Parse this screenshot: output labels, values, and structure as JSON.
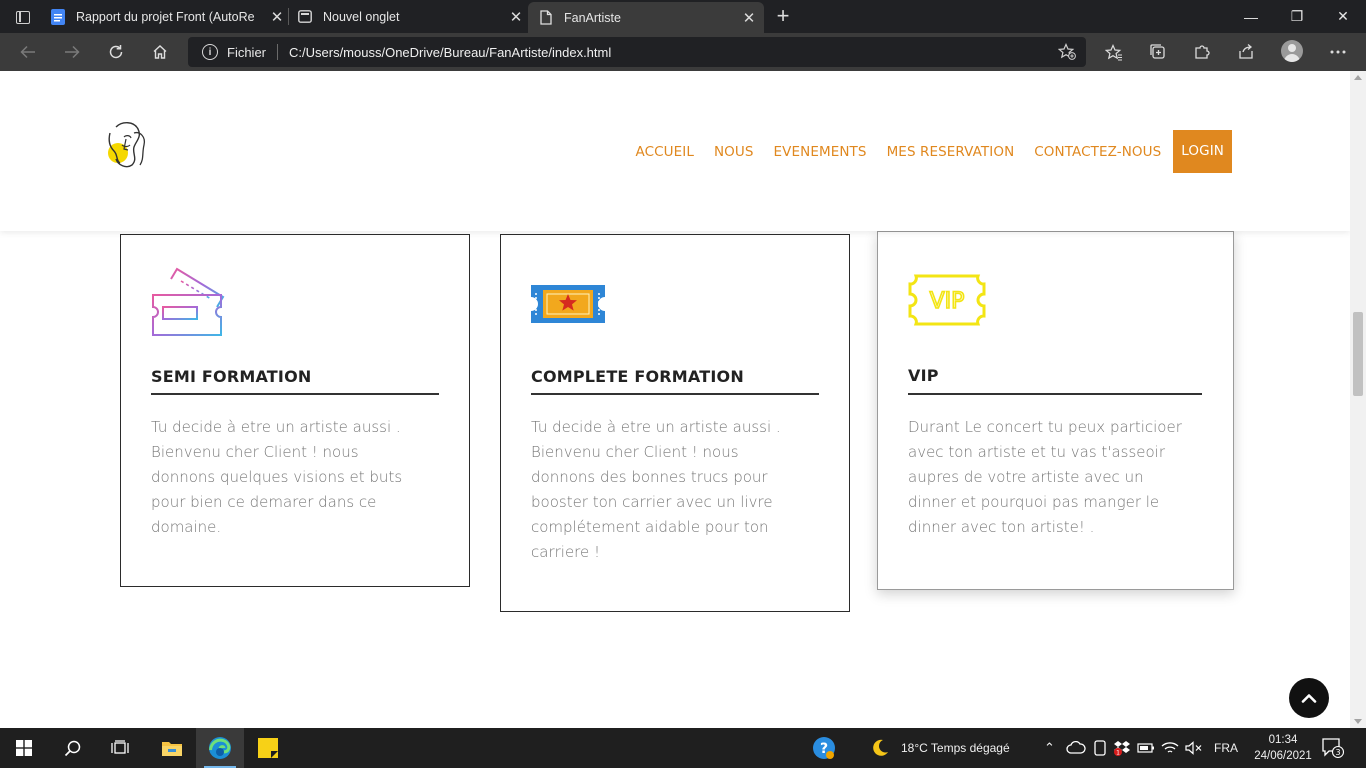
{
  "browser": {
    "tabs": [
      {
        "title": "Rapport du projet Front (AutoRe",
        "active": false
      },
      {
        "title": "Nouvel onglet",
        "active": false
      },
      {
        "title": "FanArtiste",
        "active": true
      }
    ],
    "close_glyph": "✕",
    "new_tab_glyph": "+",
    "window_controls": {
      "minimize": "—",
      "maximize": "❐",
      "close": "✕"
    },
    "address": {
      "scheme_label": "Fichier",
      "url": "C:/Users/mouss/OneDrive/Bureau/FanArtiste/index.html"
    }
  },
  "site": {
    "nav": [
      "ACCUEIL",
      "NOUS",
      "EVENEMENTS",
      "MES RESERVATION",
      "CONTACTEZ-NOUS"
    ],
    "login_label": "LOGIN",
    "accent_color": "#e0881f",
    "cards": [
      {
        "title": "SEMI FORMATION",
        "icon": "tickets-icon",
        "lines": [
          "Tu decide à etre un artiste aussi .",
          "Bienvenu cher Client ! nous",
          "donnons quelques visions et buts",
          "pour bien ce demarer dans ce",
          "domaine."
        ]
      },
      {
        "title": "COMPLETE FORMATION",
        "icon": "star-ticket-icon",
        "lines": [
          "Tu decide à etre un artiste aussi .",
          "Bienvenu cher Client ! nous",
          "donnons des bonnes trucs pour",
          "booster ton carrier avec un livre",
          "complétement aidable pour ton",
          "carriere !"
        ]
      },
      {
        "title": "VIP",
        "icon": "vip-ticket-icon",
        "icon_text": "VIP",
        "lines": [
          "Durant Le concert tu peux particioer",
          "avec ton artiste et tu vas t'asseoir",
          "aupres de votre artiste avec un",
          "dinner et pourquoi pas manger le",
          "dinner avec ton artiste! ."
        ]
      }
    ]
  },
  "taskbar": {
    "weather": "18°C  Temps dégagé",
    "language": "FRA",
    "time": "01:34",
    "date": "24/06/2021",
    "notification_count": "3",
    "mail_badge": "1"
  }
}
